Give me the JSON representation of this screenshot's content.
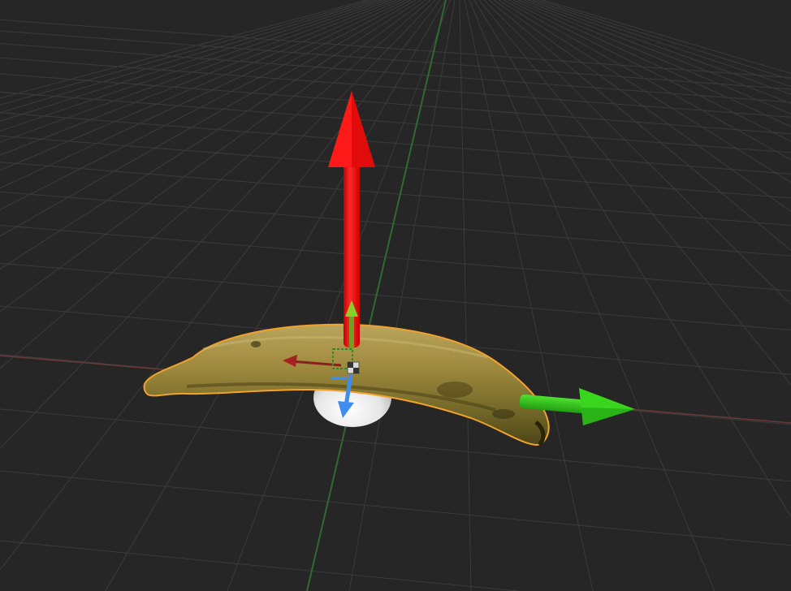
{
  "viewport": {
    "label": "",
    "background": "#262626",
    "grid_color": "#3a3a3a",
    "axis_x_color": "#6a3a3a",
    "axis_y_color": "#3a6a3a"
  },
  "scene": {
    "selected_object": "banana",
    "outline_color": "#f2a22c",
    "backdrop_sphere": "white sphere"
  },
  "gizmo": {
    "type": "translate",
    "axis_colors": {
      "up": "#ff1a1a",
      "forward": "#3ad61e",
      "depth": "#3d8ef0"
    },
    "icons": {
      "up": "arrow-up-icon",
      "forward": "arrow-right-icon",
      "depth": "arrow-down-icon",
      "center": "move-center-icon"
    }
  }
}
